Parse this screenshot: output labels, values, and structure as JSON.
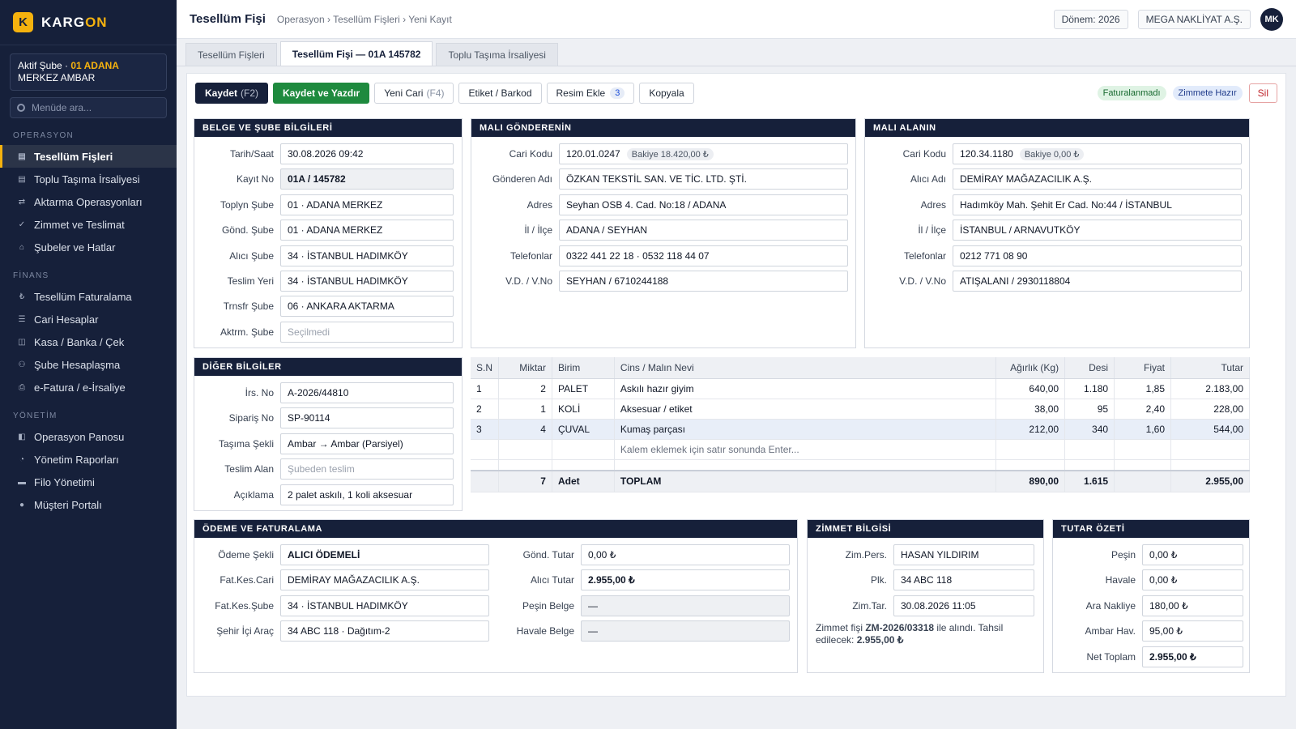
{
  "app": {
    "logo_letter": "K",
    "logo_name_pre": "KARG",
    "logo_name_hl": "ON",
    "accent": "#f5b20e",
    "navy": "#16203a"
  },
  "sidebar": {
    "branch_pre": "Aktif Şube · ",
    "branch_hl": "01 ADANA",
    "branch_post": " MERKEZ AMBAR",
    "search_placeholder": "Menüde ara...",
    "sections": [
      {
        "title": "OPERASYON",
        "items": [
          {
            "icon": "▤",
            "label": "Tesellüm Fişleri",
            "active": true
          },
          {
            "icon": "▤",
            "label": "Toplu Taşıma İrsaliyesi"
          },
          {
            "icon": "⇄",
            "label": "Aktarma Operasyonları"
          },
          {
            "icon": "✓",
            "label": "Zimmet ve Teslimat"
          },
          {
            "icon": "⌂",
            "label": "Şubeler ve Hatlar"
          }
        ]
      },
      {
        "title": "FİNANS",
        "items": [
          {
            "icon": "₺",
            "label": "Tesellüm Faturalama"
          },
          {
            "icon": "☰",
            "label": "Cari Hesaplar"
          },
          {
            "icon": "◫",
            "label": "Kasa / Banka / Çek"
          },
          {
            "icon": "⚇",
            "label": "Şube Hesaplaşma"
          },
          {
            "icon": "⎙",
            "label": "e-Fatura / e-İrsaliye"
          }
        ]
      },
      {
        "title": "YÖNETİM",
        "items": [
          {
            "icon": "◧",
            "label": "Operasyon Panosu"
          },
          {
            "icon": "◔",
            "label": "Yönetim Raporları"
          },
          {
            "icon": "▬",
            "label": "Filo Yönetimi"
          },
          {
            "icon": "●",
            "label": "Müşteri Portalı"
          }
        ]
      }
    ]
  },
  "header": {
    "title": "Tesellüm Fişi",
    "breadcrumb": "Operasyon › Tesellüm Fişleri › Yeni Kayıt",
    "period": "Dönem: 2026",
    "company": "MEGA NAKLİYAT A.Ş.",
    "user_initials": "MK"
  },
  "tabs": [
    "Tesellüm Fişleri",
    "Tesellüm Fişi — 01A 145782",
    "Toplu Taşıma İrsaliyesi"
  ],
  "toolbar": {
    "save": "Kaydet",
    "save_sc": "(F2)",
    "save_print": "Kaydet ve Yazdır",
    "new_cari": "Yeni Cari",
    "new_cari_sc": "(F4)",
    "label": "Etiket / Barkod",
    "add_image": "Resim Ekle",
    "image_count": "3",
    "copy": "Kopyala",
    "status1": "Faturalanmadı",
    "status2": "Zimmete Hazır",
    "delete": "Sil"
  },
  "belge": {
    "title": "BELGE VE ŞUBE BİLGİLERİ",
    "fields": [
      {
        "label": "Tarih/Saat",
        "value": "30.08.2026   09:42"
      },
      {
        "label": "Kayıt No",
        "value": "01A / 145782",
        "ro": true,
        "bold": true
      },
      {
        "label": "Toplyn Şube",
        "value": "01 · ADANA MERKEZ"
      },
      {
        "label": "Gönd. Şube",
        "value": "01 · ADANA MERKEZ"
      },
      {
        "label": "Alıcı Şube",
        "value": "34 · İSTANBUL HADIMKÖY"
      },
      {
        "label": "Teslim Yeri",
        "value": "34 · İSTANBUL HADIMKÖY"
      },
      {
        "label": "Trnsfr Şube",
        "value": "06 · ANKARA AKTARMA"
      },
      {
        "label": "Aktrm. Şube",
        "value": "Seçilmedi",
        "placeholder": true
      }
    ]
  },
  "sender": {
    "title": "MALI GÖNDERENİN",
    "cari_code": "120.01.0247",
    "balance": "Bakiye 18.420,00 ₺",
    "fields": [
      {
        "label": "Gönderen Adı",
        "value": "ÖZKAN TEKSTİL SAN. VE TİC. LTD. ŞTİ."
      },
      {
        "label": "Adres",
        "value": "Seyhan OSB 4. Cad. No:18 / ADANA"
      },
      {
        "label": "İl / İlçe",
        "value": "ADANA  /  SEYHAN"
      },
      {
        "label": "Telefonlar",
        "value": "0322 441 22 18  ·  0532 118 44 07"
      },
      {
        "label": "V.D. / V.No",
        "value": "SEYHAN  /  6710244188"
      }
    ],
    "cari_label": "Cari Kodu"
  },
  "receiver": {
    "title": "MALI ALANIN",
    "cari_code": "120.34.1180",
    "balance": "Bakiye 0,00 ₺",
    "fields": [
      {
        "label": "Alıcı Adı",
        "value": "DEMİRAY MAĞAZACILIK A.Ş."
      },
      {
        "label": "Adres",
        "value": "Hadımköy Mah. Şehit Er Cad. No:44 / İSTANBUL"
      },
      {
        "label": "İl / İlçe",
        "value": "İSTANBUL  /  ARNAVUTKÖY"
      },
      {
        "label": "Telefonlar",
        "value": "0212 771 08 90"
      },
      {
        "label": "V.D. / V.No",
        "value": "ATIŞALANI  /  2930118804"
      }
    ],
    "cari_label": "Cari Kodu"
  },
  "other": {
    "title": "DİĞER BİLGİLER",
    "fields": [
      {
        "label": "İrs. No",
        "value": "A-2026/44810"
      },
      {
        "label": "Sipariş No",
        "value": "SP-90114"
      },
      {
        "label": "Taşıma Şekli",
        "value": "Ambar → Ambar (Parsiyel)"
      },
      {
        "label": "Teslim Alan",
        "value": "Şubeden teslim",
        "placeholder": true
      },
      {
        "label": "Açıklama",
        "value": "2 palet askılı, 1 koli aksesuar"
      }
    ]
  },
  "items": {
    "headers": [
      "S.N",
      "Miktar",
      "Birim",
      "Cins / Malın Nevi",
      "Ağırlık (Kg)",
      "Desi",
      "Fiyat",
      "Tutar"
    ],
    "rows": [
      [
        "1",
        "2",
        "PALET",
        "Askılı hazır giyim",
        "640,00",
        "1.180",
        "1,85",
        "2.183,00"
      ],
      [
        "2",
        "1",
        "KOLİ",
        "Aksesuar / etiket",
        "38,00",
        "95",
        "2,40",
        "228,00"
      ],
      [
        "3",
        "4",
        "ÇUVAL",
        "Kumaş parçası",
        "212,00",
        "340",
        "1,60",
        "544,00"
      ]
    ],
    "hint": "Kalem eklemek için satır sonunda Enter...",
    "total": {
      "qty": "7",
      "unit": "Adet",
      "label": "TOPLAM",
      "weight": "890,00",
      "desi": "1.615",
      "amount": "2.955,00"
    }
  },
  "payment": {
    "title": "ÖDEME VE FATURALAMA",
    "left": [
      {
        "label": "Ödeme Şekli",
        "value": "ALICI ÖDEMELİ",
        "bold": true
      },
      {
        "label": "Fat.Kes.Cari",
        "value": "DEMİRAY MAĞAZACILIK A.Ş."
      },
      {
        "label": "Fat.Kes.Şube",
        "value": "34 · İSTANBUL HADIMKÖY"
      },
      {
        "label": "Şehir İçi Araç",
        "value": "34 ABC 118 · Dağıtım-2"
      }
    ],
    "right": [
      {
        "label": "Gönd. Tutar",
        "value": "0,00 ₺"
      },
      {
        "label": "Alıcı Tutar",
        "value": "2.955,00 ₺",
        "bold": true
      },
      {
        "label": "Peşin Belge",
        "value": "—",
        "ro": true
      },
      {
        "label": "Havale Belge",
        "value": "—",
        "ro": true
      }
    ]
  },
  "zimmet": {
    "title": "ZİMMET BİLGİSİ",
    "fields": [
      {
        "label": "Zim.Pers.",
        "value": "HASAN YILDIRIM"
      },
      {
        "label": "Plk.",
        "value": "34 ABC 118"
      },
      {
        "label": "Zim.Tar.",
        "value": "30.08.2026 11:05"
      }
    ],
    "note_pre": "Zimmet fişi ",
    "note_no": "ZM-2026/03318",
    "note_mid": " ile alındı. Tahsil edilecek: ",
    "note_amt": "2.955,00 ₺"
  },
  "summary": {
    "title": "TUTAR ÖZETİ",
    "fields": [
      {
        "label": "Peşin",
        "value": "0,00 ₺"
      },
      {
        "label": "Havale",
        "value": "0,00 ₺"
      },
      {
        "label": "Ara Nakliye",
        "value": "180,00 ₺"
      },
      {
        "label": "Ambar Hav.",
        "value": "95,00 ₺"
      },
      {
        "label": "Net Toplam",
        "value": "2.955,00 ₺",
        "bold": true
      }
    ]
  }
}
